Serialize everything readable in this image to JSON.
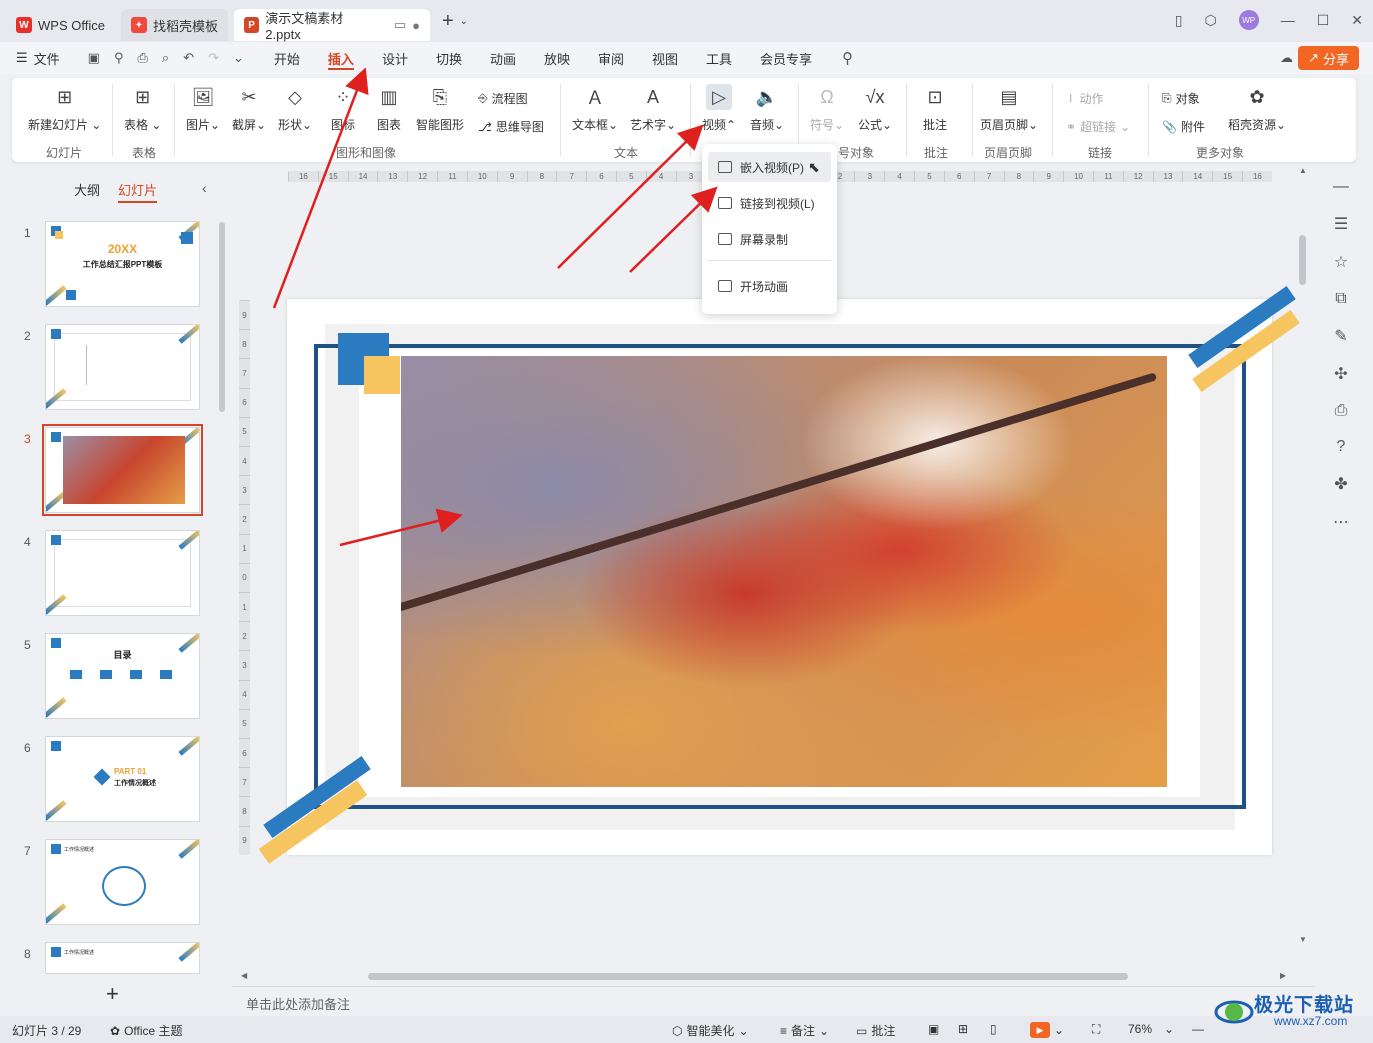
{
  "titlebar": {
    "tabs": [
      {
        "label": "WPS Office",
        "icon": "wps-logo-icon"
      },
      {
        "label": "找稻壳模板",
        "icon": "docer-logo-icon"
      },
      {
        "label": "演示文稿素材2.pptx",
        "icon": "presentation-file-icon"
      }
    ],
    "avatar_text": "WP"
  },
  "menubar": {
    "file": "文件",
    "items": [
      "开始",
      "插入",
      "设计",
      "切换",
      "动画",
      "放映",
      "审阅",
      "视图",
      "工具",
      "会员专享"
    ],
    "active": "插入",
    "share": "分享"
  },
  "ribbon": {
    "new_slide": "新建幻灯片",
    "grp_slide": "幻灯片",
    "table": "表格",
    "grp_table": "表格",
    "picture": "图片",
    "screenshot": "截屏",
    "shape": "形状",
    "icon": "图标",
    "chart": "图表",
    "smart_art": "智能图形",
    "flowchart": "流程图",
    "mindmap": "思维导图",
    "grp_graphics": "图形和图像",
    "textbox": "文本框",
    "wordart": "艺术字",
    "grp_text": "文本",
    "video": "视频",
    "audio": "音频",
    "symbol": "符号",
    "formula": "公式",
    "grp_symbol": "号对象",
    "comment": "批注",
    "grp_comment": "批注",
    "header_footer": "页眉页脚",
    "grp_header": "页眉页脚",
    "action": "动作",
    "hyperlink": "超链接",
    "grp_link": "链接",
    "object": "对象",
    "attachment": "附件",
    "docer_res": "稻壳资源",
    "grp_more": "更多对象"
  },
  "video_menu": {
    "items": [
      "嵌入视频(P)",
      "链接到视频(L)",
      "屏幕录制",
      "开场动画"
    ]
  },
  "left_panel": {
    "tab_outline": "大纲",
    "tab_slides": "幻灯片",
    "slides": [
      {
        "num": "1",
        "title": "20XX",
        "subtitle": "工作总结汇报PPT模板"
      },
      {
        "num": "2"
      },
      {
        "num": "3"
      },
      {
        "num": "4"
      },
      {
        "num": "5",
        "title": "目录"
      },
      {
        "num": "6",
        "title": "PART 01",
        "subtitle": "工作情况概述"
      },
      {
        "num": "7",
        "title": "工作情况概述"
      },
      {
        "num": "8",
        "title": "工作情况概述"
      }
    ],
    "selected": "3"
  },
  "ruler": {
    "h_ticks": [
      "16",
      "15",
      "14",
      "13",
      "12",
      "11",
      "10",
      "9",
      "8",
      "7",
      "6",
      "5",
      "4",
      "3",
      "2",
      "1",
      "0",
      "1",
      "2",
      "3",
      "4",
      "5",
      "6",
      "7",
      "8",
      "9",
      "10",
      "11",
      "12",
      "13",
      "14",
      "15",
      "16"
    ],
    "v_ticks": [
      "9",
      "8",
      "7",
      "6",
      "5",
      "4",
      "3",
      "2",
      "1",
      "0",
      "1",
      "2",
      "3",
      "4",
      "5",
      "6",
      "7",
      "8",
      "9"
    ]
  },
  "notes": {
    "placeholder": "单击此处添加备注"
  },
  "statusbar": {
    "slide_count": "幻灯片 3 / 29",
    "theme": "Office 主题",
    "beautify": "智能美化",
    "notes": "备注",
    "comment": "批注",
    "zoom": "76%"
  },
  "watermark": {
    "title": "极光下载站",
    "url": "www.xz7.com"
  },
  "colors": {
    "accent": "#d24726",
    "share": "#f26522",
    "frame": "#1f5183",
    "blue": "#2b7bc1",
    "yellow": "#f6c560",
    "arrow": "#e01f1f"
  }
}
